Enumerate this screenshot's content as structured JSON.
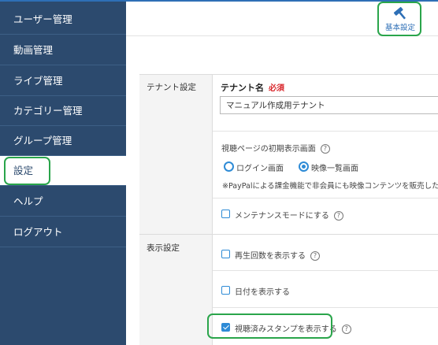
{
  "sidebar": {
    "items": [
      {
        "label": "ユーザー管理"
      },
      {
        "label": "動画管理"
      },
      {
        "label": "ライブ管理"
      },
      {
        "label": "カテゴリー管理"
      },
      {
        "label": "グループ管理"
      },
      {
        "label": "設定",
        "active": true
      },
      {
        "label": "ヘルプ"
      },
      {
        "label": "ログアウト"
      }
    ]
  },
  "header": {
    "settings_button": {
      "label": "基本設定",
      "icon": "hammer-icon"
    }
  },
  "form": {
    "tenant_section": {
      "label": "テナント設定",
      "tenant_name": {
        "title": "テナント名",
        "required": "必須",
        "value": "マニュアル作成用テナント"
      },
      "initial_screen": {
        "label": "視聴ページの初期表示画面",
        "options": [
          "ログイン画面",
          "映像一覧画面"
        ],
        "selected": "映像一覧画面",
        "note": "※PayPalによる課金機能で非会員にも映像コンテンツを販売した"
      },
      "maintenance": {
        "label": "メンテナンスモードにする",
        "checked": false
      }
    },
    "display_section": {
      "label": "表示設定",
      "options": [
        {
          "label": "再生回数を表示する",
          "checked": false
        },
        {
          "label": "日付を表示する",
          "checked": false
        },
        {
          "label": "視聴済みスタンプを表示する",
          "checked": true
        }
      ]
    }
  },
  "colors": {
    "sidebar": "#2c4a6e",
    "accent": "#2e8bd6",
    "highlight": "#2aa54b",
    "required": "#d9262b"
  }
}
